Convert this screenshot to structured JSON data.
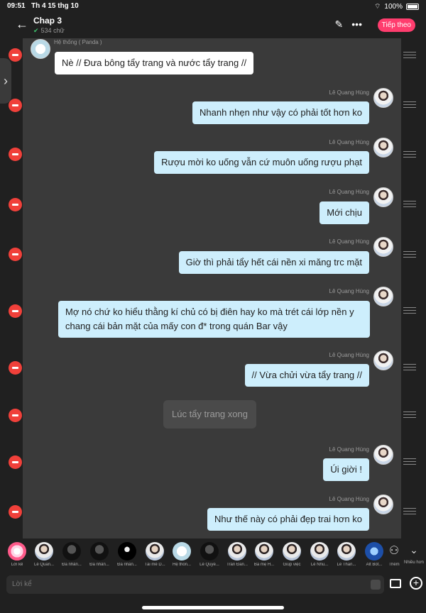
{
  "status": {
    "time": "09:51",
    "date": "Th 4 15 thg 10",
    "battery": "100%"
  },
  "header": {
    "title": "Chap 3",
    "word_count": "534 chữ",
    "next_label": "Tiếp theo"
  },
  "messages": [
    {
      "speaker": "Hệ thống ( Panda )",
      "text": "Nè // Đưa bông tẩy trang và nước tẩy trang //"
    },
    {
      "speaker": "Lê Quang Hùng",
      "text": "Nhanh nhẹn như vậy có phải tốt hơn ko"
    },
    {
      "speaker": "Lê Quang Hùng",
      "text": "Rượu mời ko uống vẫn cứ muôn uống rượu phạt"
    },
    {
      "speaker": "Lê Quang Hùng",
      "text": "Mới chịu"
    },
    {
      "speaker": "Lê Quang Hùng",
      "text": "Giờ thì phải tẩy hết cái nền xi măng trc mặt"
    },
    {
      "speaker": "Lê Quang Hùng",
      "text": "Mợ nó chứ ko hiểu thằng kí chủ có bị điên hay ko mà trét cái lớp nền y chang cái bản mặt của mấy con đ* trong quán Bar vậy"
    },
    {
      "speaker": "Lê Quang Hùng",
      "text": "// Vừa chửi vừa tẩy trang //"
    },
    {
      "speaker": "",
      "text": "Lúc tẩy trang xong"
    },
    {
      "speaker": "Lê Quang Hùng",
      "text": "Úi giời !"
    },
    {
      "speaker": "Lê Quang Hùng",
      "text": "Như thế này có phải đẹp trai hơn ko"
    }
  ],
  "characters": [
    {
      "label": "Lời kể"
    },
    {
      "label": "Lê Quan..."
    },
    {
      "label": "Đa nhân..."
    },
    {
      "label": "Đa nhân..."
    },
    {
      "label": "Đa nhân..."
    },
    {
      "label": "Tài mê D..."
    },
    {
      "label": "Hệ thốn..."
    },
    {
      "label": "Lê Quyế..."
    },
    {
      "label": "Trần Đăn..."
    },
    {
      "label": "Ba mẹ H..."
    },
    {
      "label": "Giúp việc"
    },
    {
      "label": "Lê Nhu..."
    },
    {
      "label": "Lê Than..."
    },
    {
      "label": "Alt Bot..."
    }
  ],
  "bottom": {
    "add_label": "Thêm",
    "more_label": "Nhiều hơn",
    "input_placeholder": "Lời kể"
  }
}
